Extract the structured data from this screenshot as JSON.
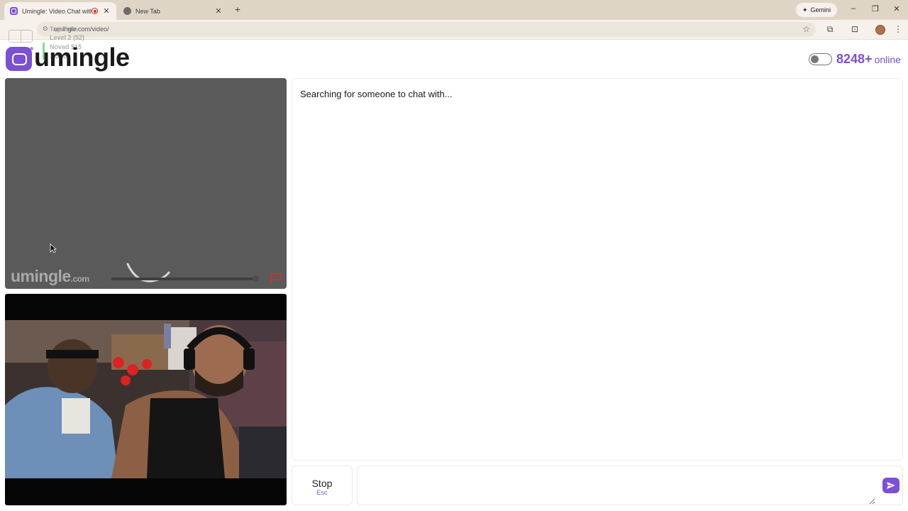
{
  "browser": {
    "tabs": [
      {
        "title": "Umingle: Video Chat with S",
        "active": true
      },
      {
        "title": "New Tab",
        "active": false
      }
    ],
    "new_tab_symbol": "+",
    "gemini_label": "Gemini",
    "url": "umingle.com/video/"
  },
  "stream_overlay": {
    "lines": [
      "Top Train",
      "Level 2 (52)",
      "Novad $15",
      "3 Subs"
    ]
  },
  "site": {
    "logo_text": "umingle",
    "online_count": "8248+",
    "online_label": "online"
  },
  "stranger_video": {
    "watermark_main": "umingle",
    "watermark_domain": ".com",
    "volume_level": 1.0
  },
  "chat": {
    "status_text": "Searching for someone to chat with...",
    "stop_label": "Stop",
    "stop_shortcut": "Esc",
    "message_placeholder": ""
  },
  "colors": {
    "brand": "#7b4fd6",
    "report": "#d0312d"
  },
  "icons": [
    "umingle-icon",
    "record-icon",
    "gemini-icon",
    "reload-icon",
    "star-icon",
    "extensions-icon",
    "media-icon",
    "menu-icon",
    "flag-icon",
    "send-icon",
    "spinner-icon",
    "cursor-icon"
  ]
}
